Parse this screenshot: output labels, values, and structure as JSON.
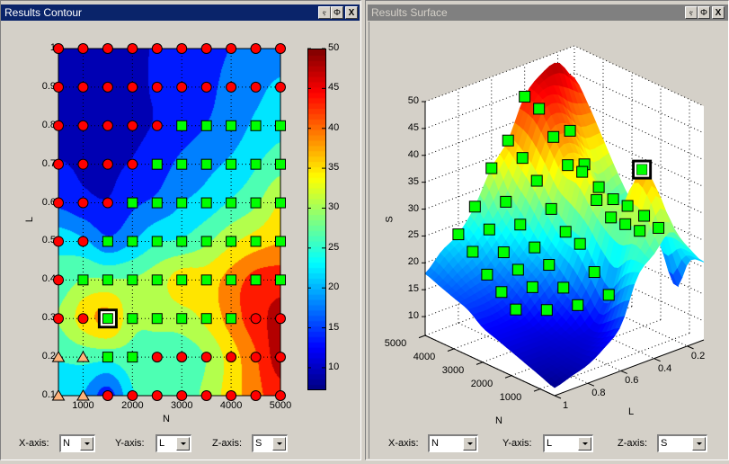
{
  "windows": {
    "contour": {
      "title": "Results Contour",
      "buttons": [
        "undock",
        "maximize",
        "close"
      ],
      "button_glyphs": [
        "ⲋ",
        "Φ",
        "X"
      ]
    },
    "surface": {
      "title": "Results Surface",
      "buttons": [
        "undock",
        "maximize",
        "close"
      ],
      "button_glyphs": [
        "ⲋ",
        "Φ",
        "X"
      ]
    }
  },
  "contour_controls": {
    "x_label": "X-axis:",
    "x_value": "N",
    "y_label": "Y-axis:",
    "y_value": "L",
    "z_label": "Z-axis:",
    "z_value": "S"
  },
  "surface_controls": {
    "x_label": "X-axis:",
    "x_value": "N",
    "y_label": "Y-axis:",
    "y_value": "L",
    "z_label": "Z-axis:",
    "z_value": "S"
  },
  "colors": {
    "active_title": "#0a246a",
    "inactive_title": "#808080",
    "circle_marker": "#ff0000",
    "square_marker": "#00ff00",
    "triangle_marker": "#ffb27a"
  },
  "chart_data": [
    {
      "type": "contour",
      "colormap": "jet",
      "xlabel": "N",
      "ylabel": "L",
      "x": [
        500,
        1000,
        1500,
        2000,
        2500,
        3000,
        3500,
        4000,
        4500,
        5000
      ],
      "y": [
        0.1,
        0.2,
        0.3,
        0.4,
        0.5,
        0.6,
        0.7,
        0.8,
        0.9,
        1.0
      ],
      "z": [
        [
          21,
          20,
          14,
          24,
          25,
          26,
          30,
          35,
          40,
          44
        ],
        [
          25,
          26,
          26,
          27,
          26,
          26,
          29,
          35,
          41,
          48
        ],
        [
          29,
          35,
          38,
          30,
          30,
          31,
          34,
          39,
          44,
          47
        ],
        [
          26,
          29,
          29,
          29,
          31,
          35,
          35,
          39,
          43,
          44
        ],
        [
          23,
          21,
          17,
          20,
          24,
          25,
          28,
          32,
          35,
          37
        ],
        [
          15,
          13,
          12,
          15,
          17,
          20,
          22,
          25,
          28,
          33
        ],
        [
          12,
          11,
          11,
          12,
          14,
          17,
          19,
          21,
          24,
          27
        ],
        [
          10,
          10,
          10.5,
          11,
          12,
          14,
          16,
          18,
          21,
          23
        ],
        [
          9,
          9.5,
          10,
          11,
          12,
          13,
          15,
          17,
          19,
          21
        ],
        [
          8,
          9,
          10,
          11,
          12,
          13,
          15,
          16,
          17,
          18
        ]
      ],
      "markers": [
        [
          "triangle",
          "triangle",
          "circle",
          "circle",
          "circle",
          "circle",
          "circle",
          "circle",
          "circle",
          "circle"
        ],
        [
          "triangle",
          "triangle",
          "square",
          "square",
          "circle",
          "circle",
          "circle",
          "circle",
          "circle",
          "circle"
        ],
        [
          "circle",
          "circle",
          "square",
          "square",
          "square",
          "square",
          "square",
          "square",
          "circle",
          "circle"
        ],
        [
          "circle",
          "square",
          "square",
          "square",
          "square",
          "square",
          "square",
          "square",
          "square",
          "square"
        ],
        [
          "circle",
          "circle",
          "square",
          "square",
          "square",
          "square",
          "square",
          "square",
          "square",
          "square"
        ],
        [
          "circle",
          "circle",
          "circle",
          "square",
          "square",
          "square",
          "square",
          "square",
          "square",
          "square"
        ],
        [
          "circle",
          "circle",
          "circle",
          "circle",
          "square",
          "square",
          "square",
          "square",
          "square",
          "square"
        ],
        [
          "circle",
          "circle",
          "circle",
          "circle",
          "circle",
          "square",
          "square",
          "square",
          "square",
          "square"
        ],
        [
          "circle",
          "circle",
          "circle",
          "circle",
          "circle",
          "circle",
          "circle",
          "circle",
          "circle",
          "circle"
        ],
        [
          "circle",
          "circle",
          "circle",
          "circle",
          "circle",
          "circle",
          "circle",
          "circle",
          "circle",
          "circle"
        ]
      ],
      "selected": {
        "N": 1500,
        "L": 0.3
      },
      "xticks": [
        "1000",
        "2000",
        "3000",
        "4000",
        "5000"
      ],
      "yticks": [
        "0.1",
        "0.2",
        "0.3",
        "0.4",
        "0.5",
        "0.6",
        "0.7",
        "0.8",
        "0.9",
        "1"
      ],
      "xlim": [
        500,
        5000
      ],
      "ylim": [
        0.1,
        1
      ],
      "grid": true,
      "colorbar": {
        "ticks": [
          "10",
          "15",
          "20",
          "25",
          "30",
          "35",
          "40",
          "45",
          "50"
        ],
        "clim": [
          7.4,
          50
        ],
        "levels": 10
      }
    },
    {
      "type": "surface",
      "colormap": "jet",
      "xlabel": "N",
      "ylabel": "L",
      "zlabel": "S",
      "x": [
        500,
        1000,
        1500,
        2000,
        2500,
        3000,
        3500,
        4000,
        4500,
        5000
      ],
      "y": [
        0.1,
        0.2,
        0.3,
        0.4,
        0.5,
        0.6,
        0.7,
        0.8,
        0.9,
        1.0
      ],
      "z": [
        [
          21,
          20,
          14,
          24,
          25,
          26,
          30,
          35,
          40,
          44
        ],
        [
          25,
          26,
          26,
          27,
          26,
          26,
          29,
          35,
          41,
          48
        ],
        [
          29,
          35,
          38,
          30,
          30,
          31,
          34,
          39,
          44,
          47
        ],
        [
          26,
          29,
          29,
          29,
          31,
          35,
          35,
          39,
          43,
          44
        ],
        [
          23,
          21,
          17,
          20,
          24,
          25,
          28,
          32,
          35,
          37
        ],
        [
          15,
          13,
          12,
          15,
          17,
          20,
          22,
          25,
          28,
          33
        ],
        [
          12,
          11,
          11,
          12,
          14,
          17,
          19,
          21,
          24,
          27
        ],
        [
          10,
          10,
          10.5,
          11,
          12,
          14,
          16,
          18,
          21,
          23
        ],
        [
          9,
          9.5,
          10,
          11,
          12,
          13,
          15,
          17,
          19,
          21
        ],
        [
          8,
          9,
          10,
          11,
          12,
          13,
          15,
          16,
          17,
          18
        ]
      ],
      "markers": "square",
      "selected": {
        "N": 1500,
        "L": 0.3
      },
      "xticks": [
        "1000",
        "2000",
        "3000",
        "4000",
        "5000"
      ],
      "yticks": [
        "0.2",
        "0.4",
        "0.6",
        "0.8",
        "1"
      ],
      "zticks": [
        "10",
        "15",
        "20",
        "25",
        "30",
        "35",
        "40",
        "45",
        "50"
      ],
      "zlim": [
        6.5,
        50
      ],
      "grid": true
    }
  ]
}
